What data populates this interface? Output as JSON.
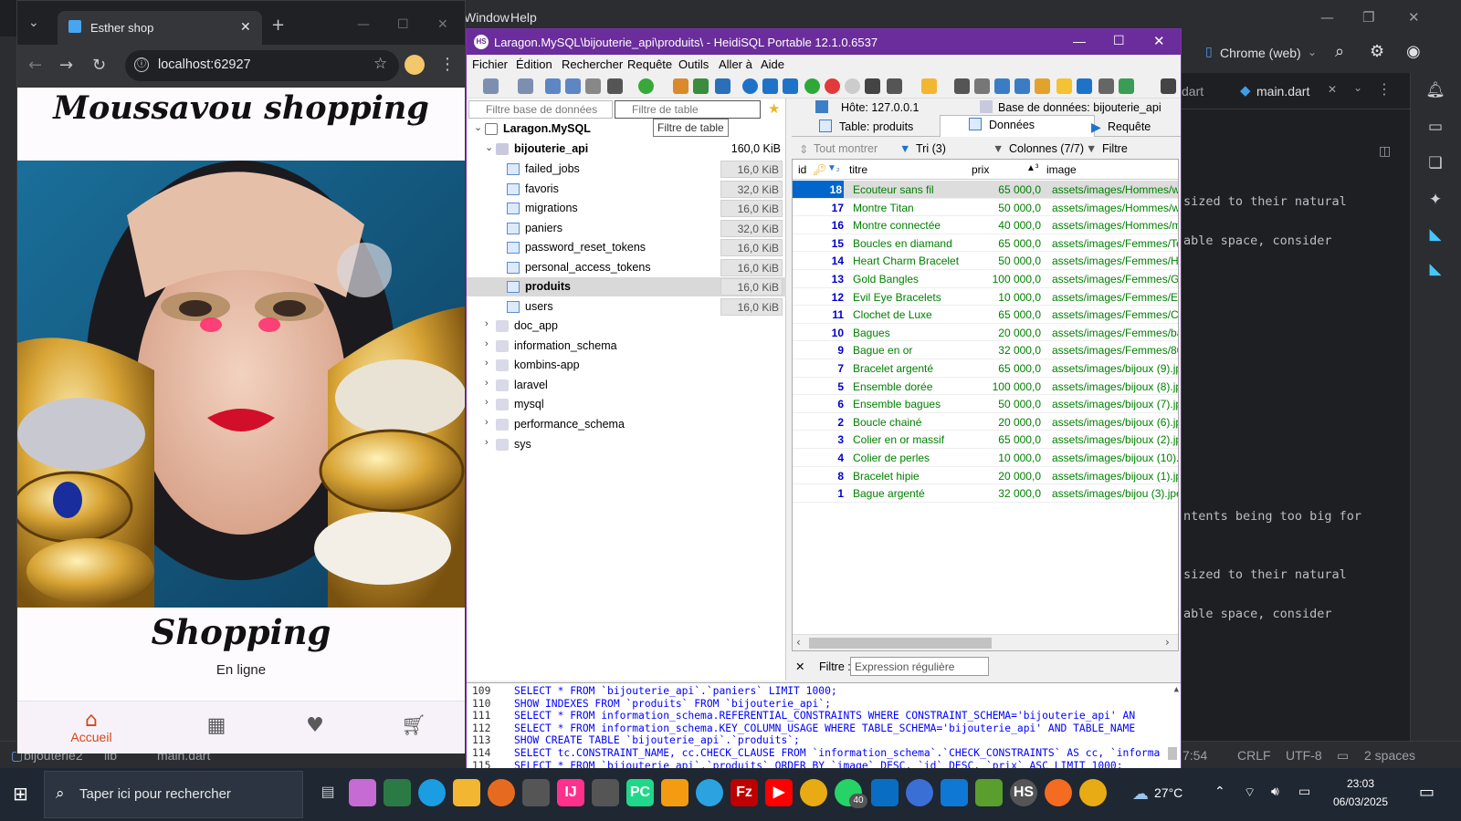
{
  "ide": {
    "menu_window": "Window",
    "menu_help": "Help",
    "run_config": "Chrome (web)",
    "tab_prev": "dart",
    "tab_active": "main.dart",
    "code_lines": [
      "sized to their natural",
      "able space, consider",
      "ntents being too big for",
      "sized to their natural",
      "able space, consider"
    ],
    "breadcrumb": [
      "bijouterie2",
      "lib",
      "main.dart"
    ],
    "status_position": "7:54",
    "status_crlf": "CRLF",
    "status_encoding": "UTF-8",
    "status_indent": "2 spaces"
  },
  "chrome": {
    "tab_title": "Esther shop",
    "url": "localhost:62927"
  },
  "app": {
    "title": "Moussavou shopping",
    "heading": "Shopping",
    "subtitle": "En ligne",
    "nav": [
      {
        "label": "Accueil",
        "icon": "home-icon",
        "active": true
      },
      {
        "label": "",
        "icon": "grid-icon",
        "active": false
      },
      {
        "label": "",
        "icon": "heart-icon",
        "active": false
      },
      {
        "label": "",
        "icon": "cart-icon",
        "active": false
      }
    ],
    "active_color": "#d84315"
  },
  "heidi": {
    "window_title": "Laragon.MySQL\\bijouterie_api\\produits\\ - HeidiSQL Portable 12.1.0.6537",
    "menu": [
      "Fichier",
      "Édition",
      "Rechercher",
      "Requête",
      "Outils",
      "Aller à",
      "Aide"
    ],
    "filter_db_placeholder": "Filtre base de données",
    "filter_table_placeholder": "Filtre de table",
    "tooltip": "Filtre de table",
    "tabs": {
      "host": "Hôte: 127.0.0.1",
      "database": "Base de données: bijouterie_api",
      "table": "Table: produits",
      "data": "Données",
      "query": "Requête"
    },
    "data_toolbar": {
      "show_all": "Tout montrer",
      "sort": "Tri (3)",
      "columns": "Colonnes (7/7)",
      "filter": "Filtre"
    },
    "tree": {
      "root": "Laragon.MySQL",
      "db": "bijouterie_api",
      "db_size": "160,0 KiB",
      "tables": [
        {
          "name": "failed_jobs",
          "size": "16,0 KiB"
        },
        {
          "name": "favoris",
          "size": "32,0 KiB"
        },
        {
          "name": "migrations",
          "size": "16,0 KiB"
        },
        {
          "name": "paniers",
          "size": "32,0 KiB"
        },
        {
          "name": "password_reset_tokens",
          "size": "16,0 KiB"
        },
        {
          "name": "personal_access_tokens",
          "size": "16,0 KiB"
        },
        {
          "name": "produits",
          "size": "16,0 KiB"
        },
        {
          "name": "users",
          "size": "16,0 KiB"
        }
      ],
      "other_dbs": [
        "doc_app",
        "information_schema",
        "kombins-app",
        "laravel",
        "mysql",
        "performance_schema",
        "sys"
      ]
    },
    "columns": [
      "id",
      "titre",
      "prix",
      "image"
    ],
    "rows": [
      {
        "id": "18",
        "titre": "Ecouteur sans fil",
        "prix": "65 000,0",
        "image": "assets/images/Hommes/wirele"
      },
      {
        "id": "17",
        "titre": "Montre Titan",
        "prix": "50 000,0",
        "image": "assets/images/Hommes/watc"
      },
      {
        "id": "16",
        "titre": "Montre connectée",
        "prix": "40 000,0",
        "image": "assets/images/Hommes/miba"
      },
      {
        "id": "15",
        "titre": "Boucles en diamand",
        "prix": "65 000,0",
        "image": "assets/images/Femmes/Temp"
      },
      {
        "id": "14",
        "titre": "Heart Charm Bracelet",
        "prix": "50 000,0",
        "image": "assets/images/Femmes/Hear"
      },
      {
        "id": "13",
        "titre": "Gold Bangles",
        "prix": "100 000,0",
        "image": "assets/images/Femmes/Gold"
      },
      {
        "id": "12",
        "titre": "Evil Eye Bracelets",
        "prix": "10 000,0",
        "image": "assets/images/Femmes/Evil E"
      },
      {
        "id": "11",
        "titre": "Clochet de Luxe",
        "prix": "65 000,0",
        "image": "assets/images/Femmes/Close"
      },
      {
        "id": "10",
        "titre": "Bagues",
        "prix": "20 000,0",
        "image": "assets/images/Femmes/bagu"
      },
      {
        "id": "9",
        "titre": "Bague en or",
        "prix": "32 000,0",
        "image": "assets/images/Femmes/802a"
      },
      {
        "id": "7",
        "titre": "Bracelet argenté",
        "prix": "65 000,0",
        "image": "assets/images/bijoux (9).jpeg"
      },
      {
        "id": "5",
        "titre": "Ensemble dorée",
        "prix": "100 000,0",
        "image": "assets/images/bijoux (8).jpeg"
      },
      {
        "id": "6",
        "titre": "Ensemble bagues",
        "prix": "50 000,0",
        "image": "assets/images/bijoux (7).jpeg"
      },
      {
        "id": "2",
        "titre": "Boucle chainé",
        "prix": "20 000,0",
        "image": "assets/images/bijoux (6).jpeg"
      },
      {
        "id": "3",
        "titre": "Colier en or massif",
        "prix": "65 000,0",
        "image": "assets/images/bijoux (2).jpeg"
      },
      {
        "id": "4",
        "titre": "Colier de perles",
        "prix": "10 000,0",
        "image": "assets/images/bijoux (10).jpe"
      },
      {
        "id": "8",
        "titre": "Bracelet hipie",
        "prix": "20 000,0",
        "image": "assets/images/bijoux (1).jpeg"
      },
      {
        "id": "1",
        "titre": "Bague argenté",
        "prix": "32 000,0",
        "image": "assets/images/bijou (3).jpeg"
      }
    ],
    "filter_label": "Filtre :",
    "filter_placeholder": "Expression régulière",
    "sql_lines": [
      {
        "n": "109",
        "code": "SELECT * FROM `bijouterie_api`.`paniers` LIMIT 1000;"
      },
      {
        "n": "110",
        "code": "SHOW INDEXES FROM `produits` FROM `bijouterie_api`;"
      },
      {
        "n": "111",
        "code": "SELECT * FROM information_schema.REFERENTIAL_CONSTRAINTS WHERE   CONSTRAINT_SCHEMA='bijouterie_api'   AN"
      },
      {
        "n": "112",
        "code": "SELECT * FROM information_schema.KEY_COLUMN_USAGE WHERE   TABLE_SCHEMA='bijouterie_api'   AND TABLE_NAME"
      },
      {
        "n": "113",
        "code": "SHOW CREATE TABLE `bijouterie_api`.`produits`;"
      },
      {
        "n": "114",
        "code": "SELECT tc.CONSTRAINT_NAME, cc.CHECK_CLAUSE FROM `information_schema`.`CHECK_CONSTRAINTS` AS cc, `informa"
      },
      {
        "n": "115",
        "code": "SELECT * FROM `bijouterie_api`.`produits` ORDER BY `image` DESC, `id` DESC, `prix` ASC LIMIT 1000;"
      }
    ]
  },
  "taskbar": {
    "search_placeholder": "Taper ici pour rechercher",
    "whatsapp_badge": "40",
    "temperature": "27°C",
    "time": "23:03",
    "date": "06/03/2025"
  }
}
